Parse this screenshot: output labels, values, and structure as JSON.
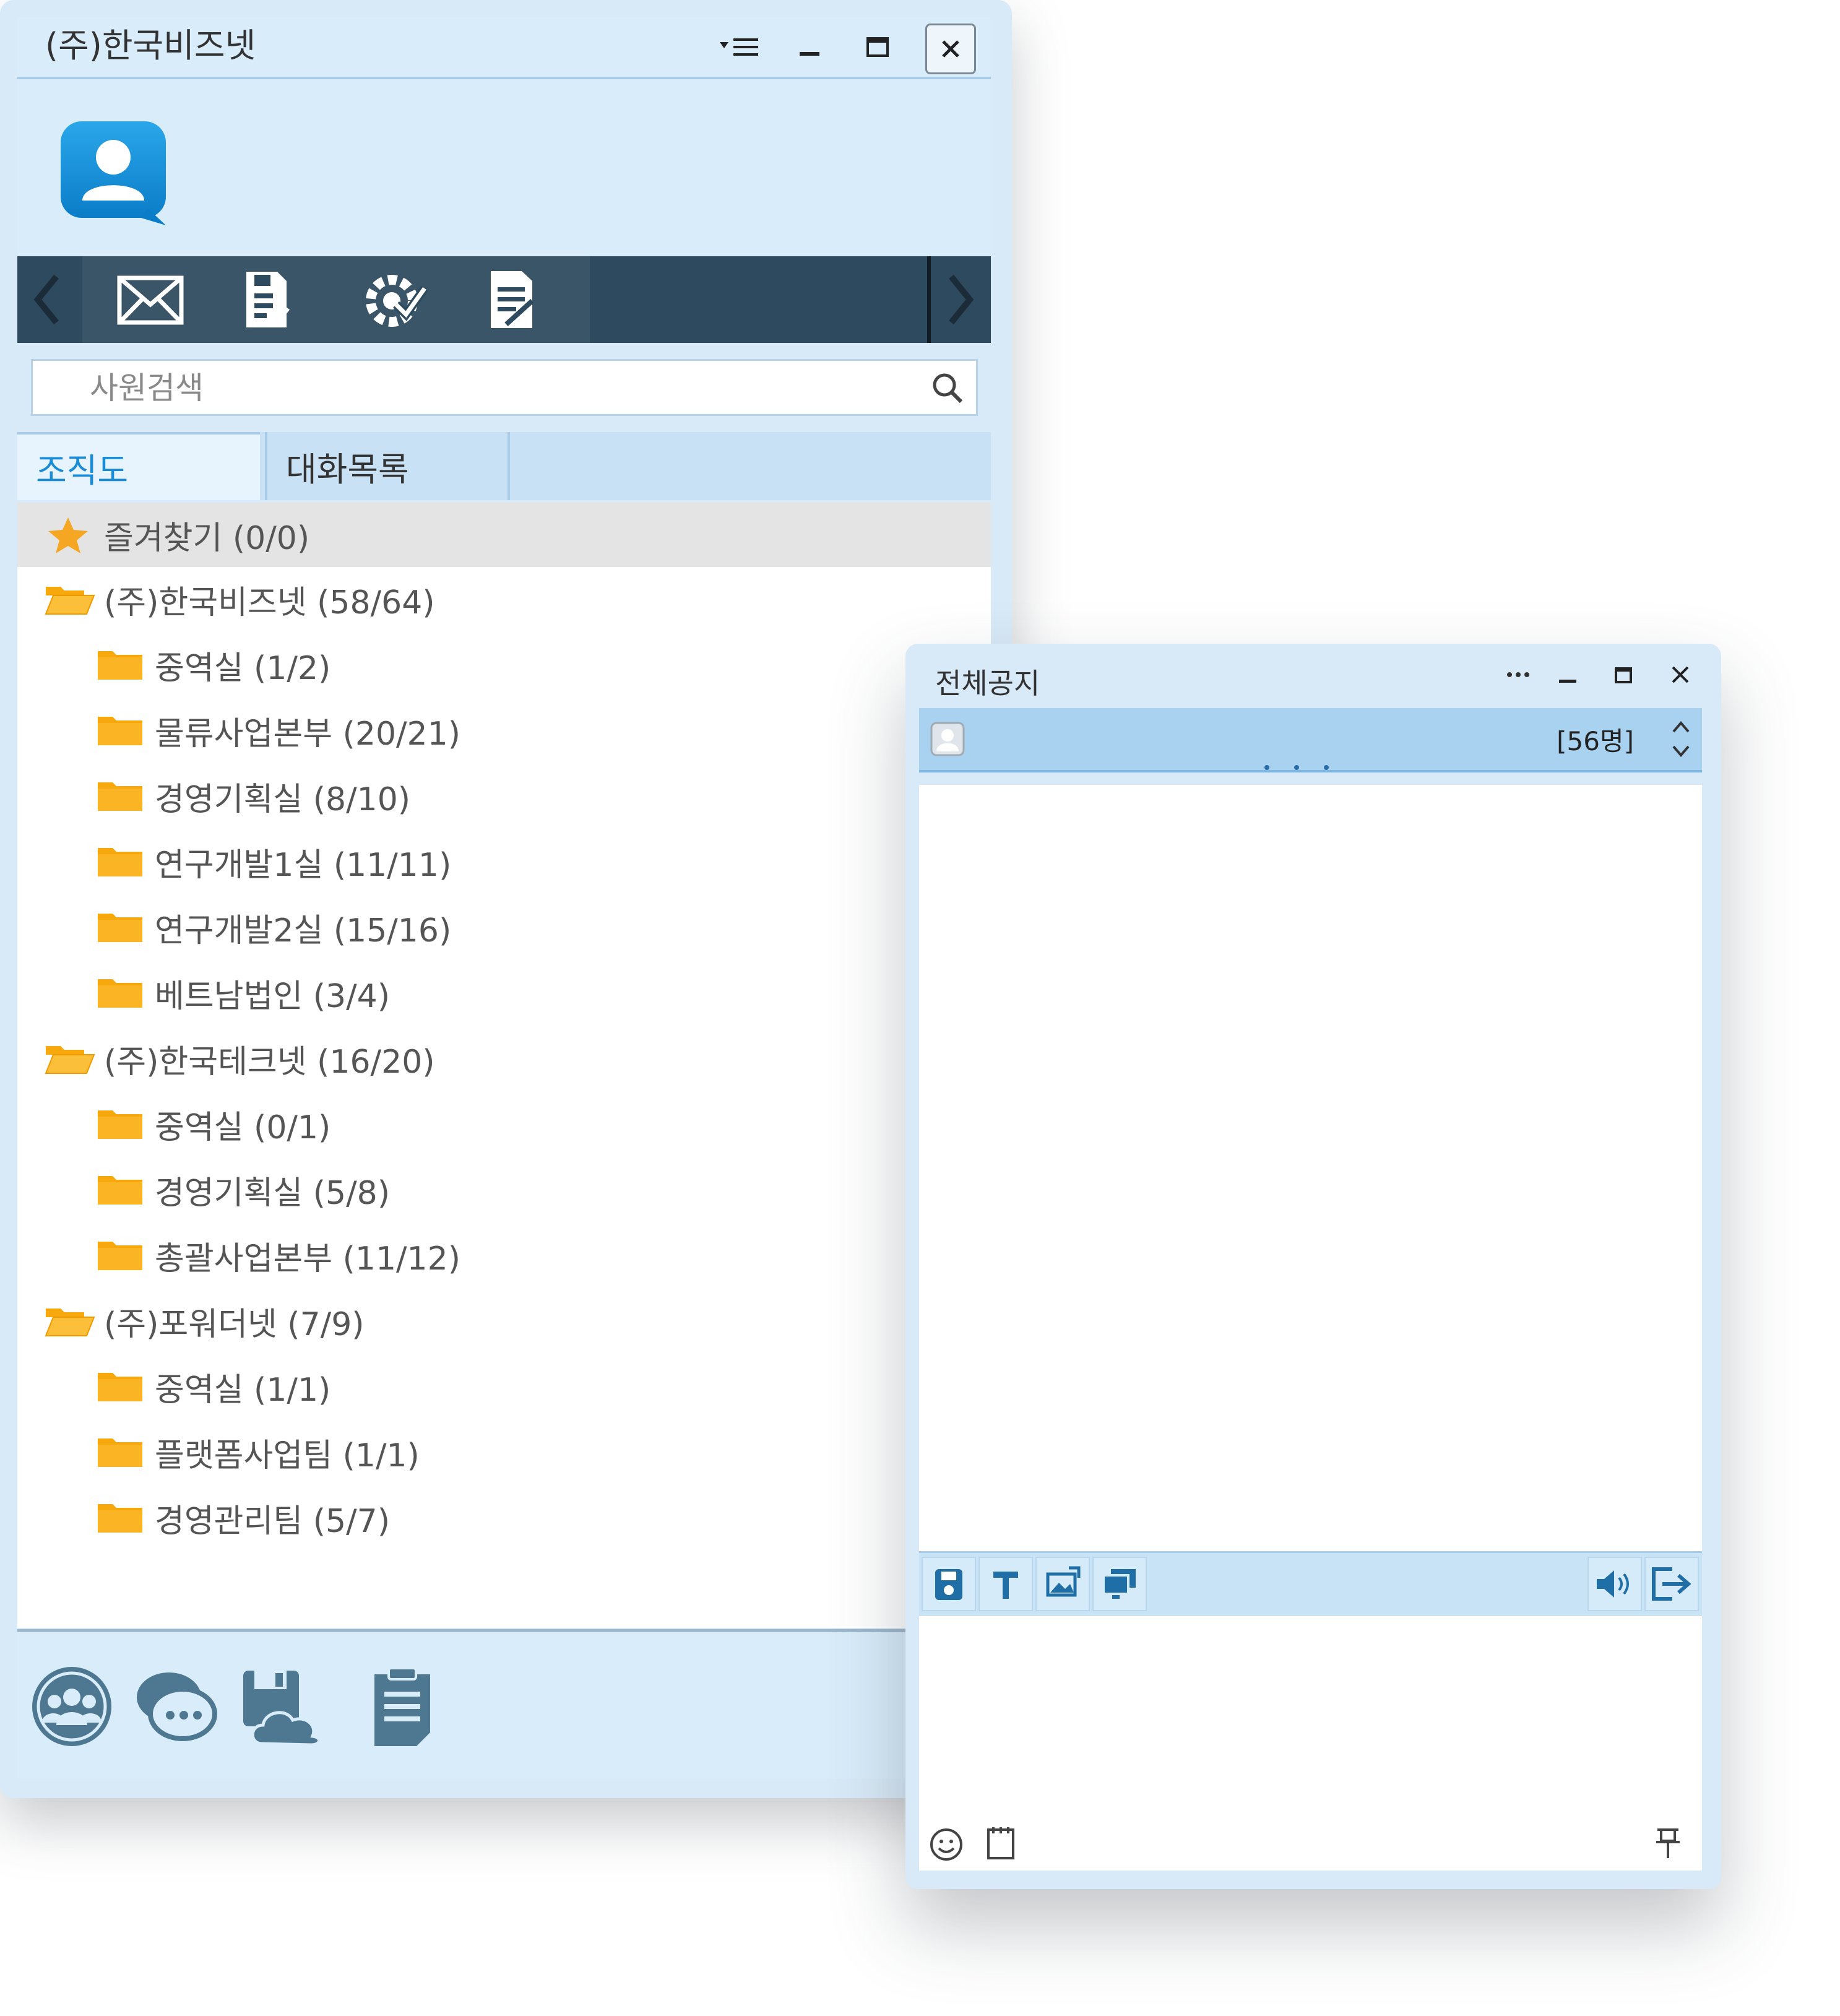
{
  "main_window": {
    "title": "(주)한국비즈넷",
    "title_buttons": [
      "menu-icon",
      "minimize-icon",
      "maximize-icon",
      "close-icon"
    ],
    "toolbar_icons": [
      "mail-icon",
      "file-save-icon",
      "settings-check-icon",
      "document-edit-icon"
    ],
    "search": {
      "placeholder": "사원검색"
    },
    "tabs": [
      {
        "label": "조직도",
        "active": true
      },
      {
        "label": "대화목록",
        "active": false
      }
    ],
    "tree": {
      "favorites": "즐겨찾기 (0/0)",
      "rows": [
        {
          "label": "(주)한국비즈넷 (58/64)",
          "level": 0,
          "open": true
        },
        {
          "label": "중역실 (1/2)",
          "level": 1
        },
        {
          "label": "물류사업본부 (20/21)",
          "level": 1
        },
        {
          "label": "경영기획실 (8/10)",
          "level": 1
        },
        {
          "label": "연구개발1실 (11/11)",
          "level": 1
        },
        {
          "label": "연구개발2실 (15/16)",
          "level": 1
        },
        {
          "label": "베트남법인 (3/4)",
          "level": 1
        },
        {
          "label": "(주)한국테크넷 (16/20)",
          "level": 0,
          "open": true
        },
        {
          "label": "중역실 (0/1)",
          "level": 1
        },
        {
          "label": "경영기획실 (5/8)",
          "level": 1
        },
        {
          "label": "총괄사업본부 (11/12)",
          "level": 1
        },
        {
          "label": "(주)포워더넷 (7/9)",
          "level": 0,
          "open": true
        },
        {
          "label": "중역실 (1/1)",
          "level": 1
        },
        {
          "label": "플랫폼사업팀 (1/1)",
          "level": 1
        },
        {
          "label": "경영관리팀 (5/7)",
          "level": 1
        }
      ]
    },
    "bottom_icons": [
      "users-icon",
      "chat-icon",
      "cloud-storage-icon",
      "notepad-icon"
    ]
  },
  "notice_window": {
    "title": "전체공지",
    "title_buttons": [
      "more-icon",
      "minimize-icon",
      "maximize-icon",
      "close-icon"
    ],
    "member_count": "[56명]",
    "format_tools": [
      "save-icon",
      "text-format-icon",
      "image-icon",
      "screen-share-icon"
    ],
    "right_tools": [
      "speaker-icon",
      "exit-icon"
    ],
    "input_tools": [
      "emoji-icon",
      "memo-icon",
      "pin-icon"
    ]
  },
  "colors": {
    "window_bg": "#d8e9f7",
    "toolbar_bg": "#2e4a5e",
    "accent": "#1a8bd6",
    "folder": "#f7a80c",
    "star": "#f5a623"
  }
}
